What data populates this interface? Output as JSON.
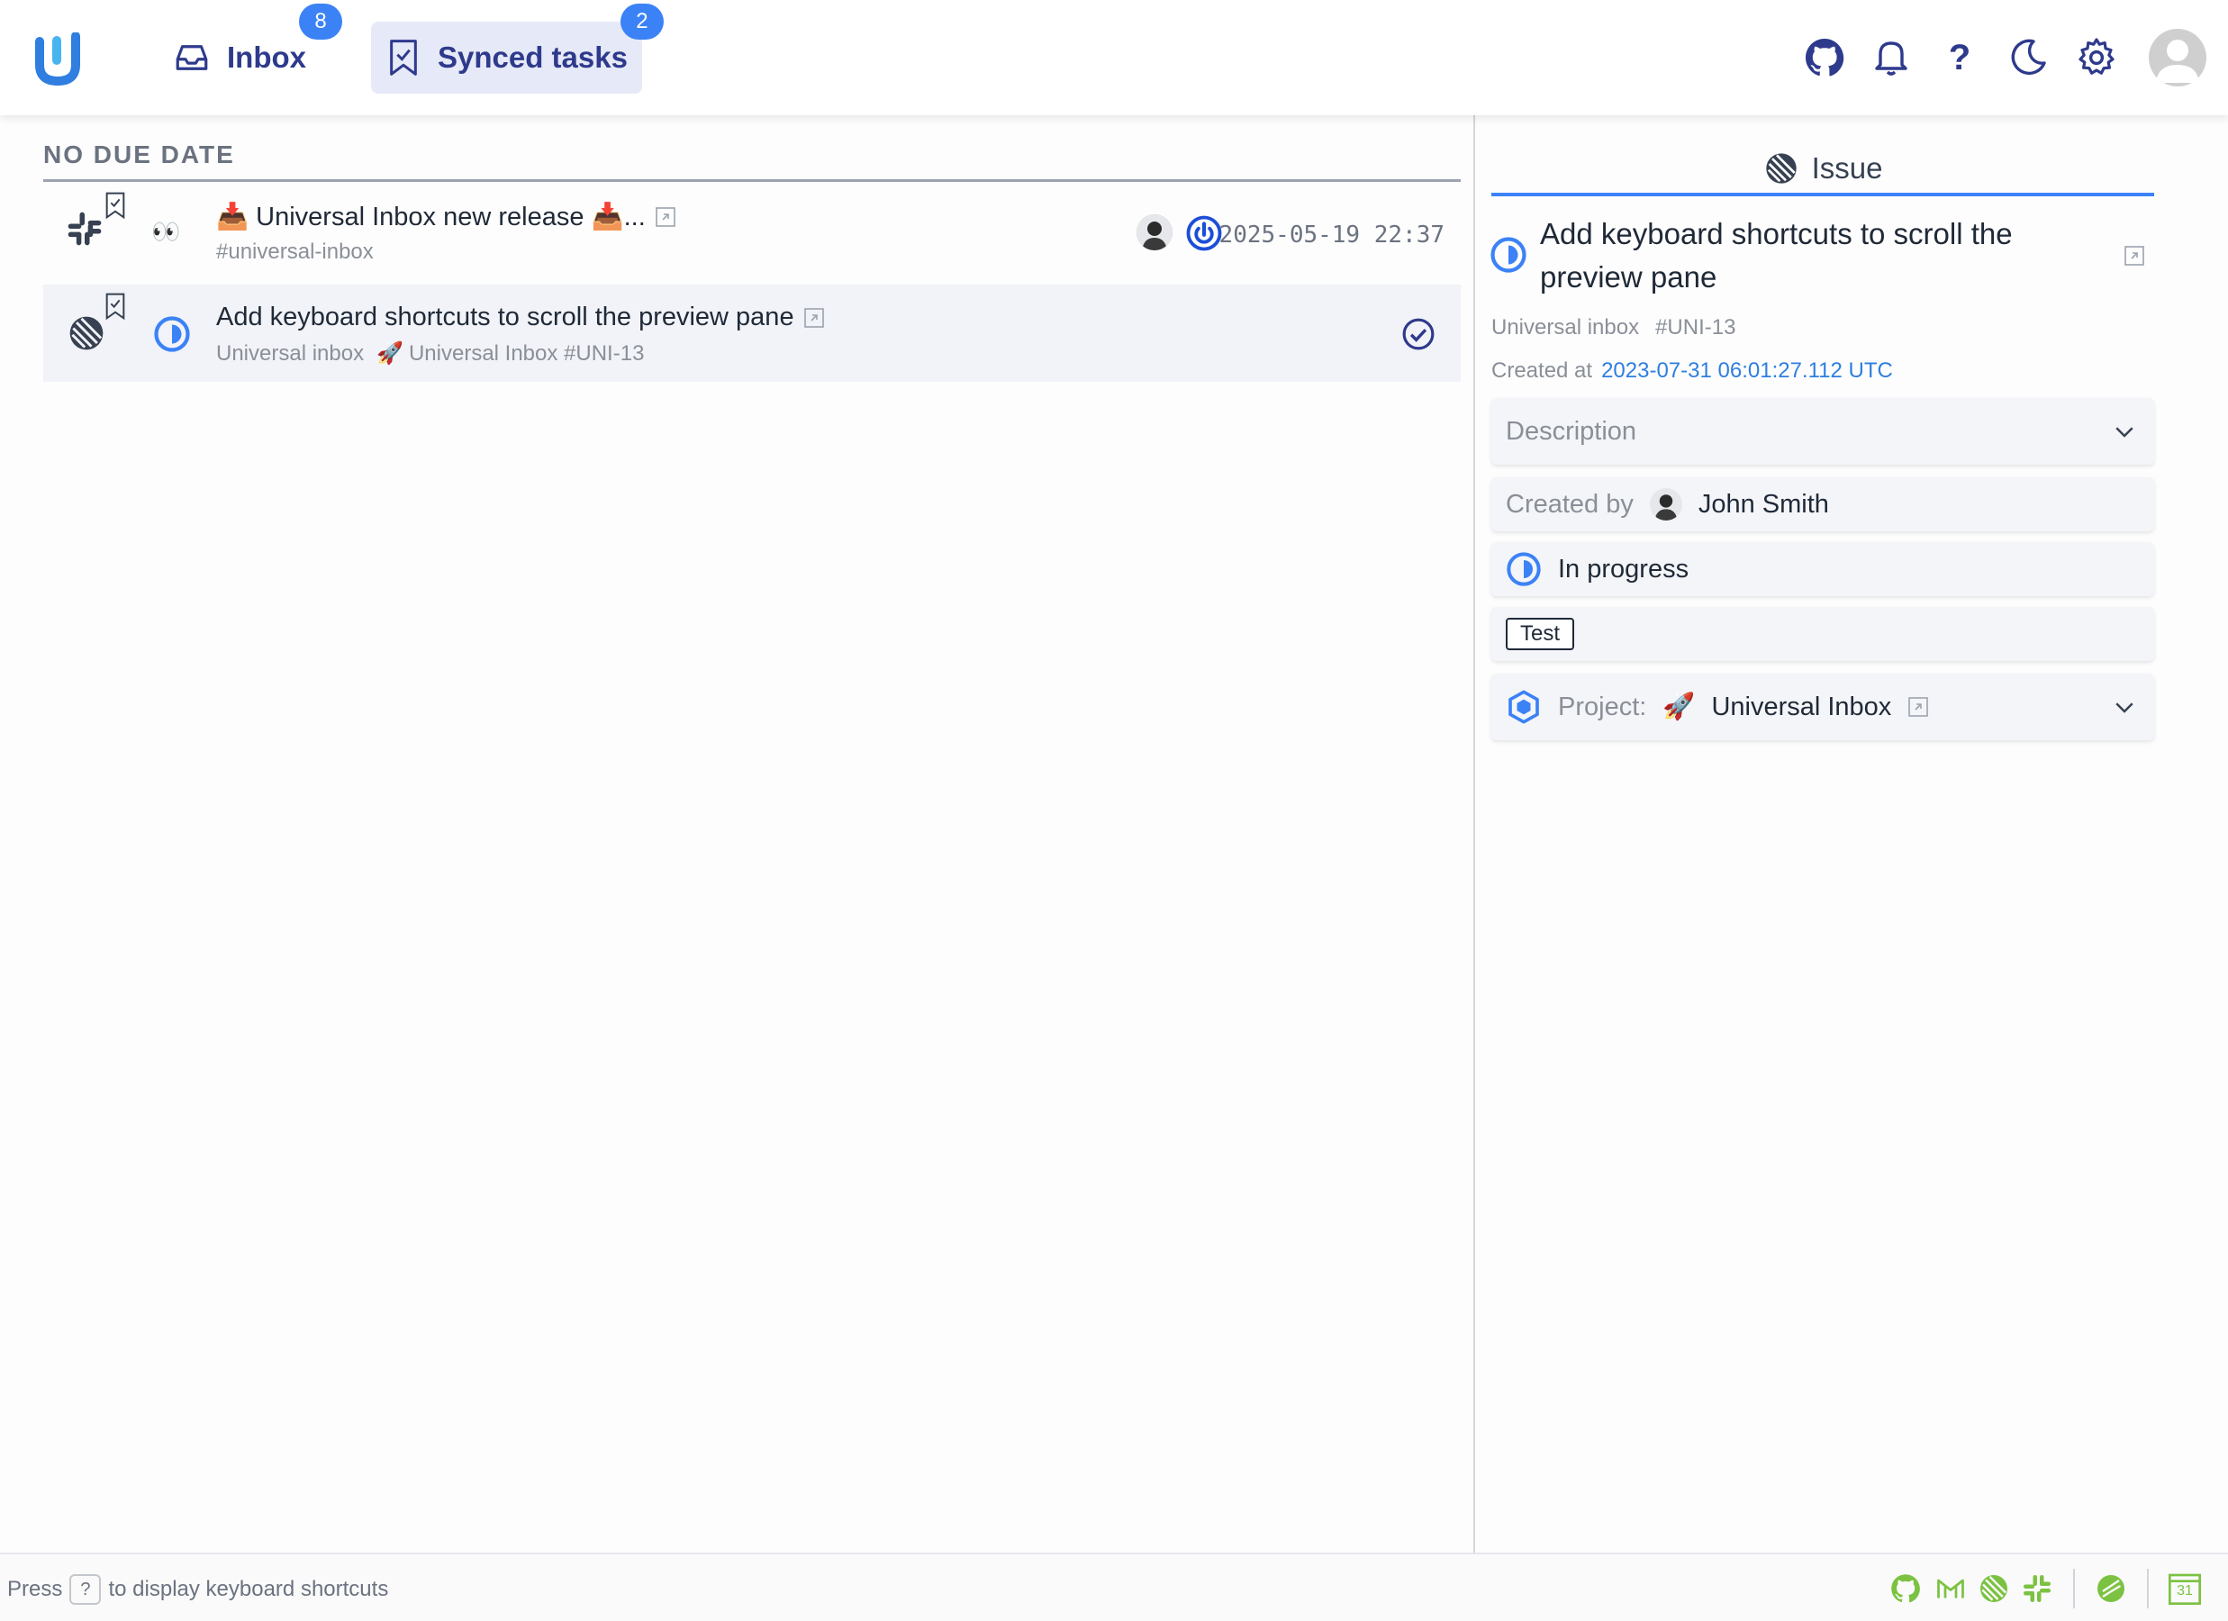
{
  "header": {
    "tabs": [
      {
        "label": "Inbox",
        "badge": "8",
        "icon": "inbox-tray-icon"
      },
      {
        "label": "Synced tasks",
        "badge": "2",
        "icon": "bookmark-check-icon"
      }
    ],
    "icons": [
      "github-icon",
      "bell-icon",
      "help-icon",
      "moon-icon",
      "gear-icon",
      "avatar"
    ],
    "question_mark": "?"
  },
  "list": {
    "section_title": "NO DUE DATE",
    "rows": [
      {
        "source_icon": "slack-icon",
        "title": "📥 Universal Inbox new release 📥...",
        "subtitle": "#universal-inbox",
        "emoji": "👀",
        "date": "2025-05-19 22:37"
      },
      {
        "source_icon": "linear-icon",
        "title": "Add keyboard shortcuts to scroll the preview pane",
        "subtitle_project": "Universal inbox",
        "subtitle_rocket": "🚀",
        "subtitle_ref": "Universal Inbox #UNI-13"
      }
    ]
  },
  "preview": {
    "header_label": "Issue",
    "title": "Add keyboard shortcuts to scroll the preview pane",
    "project": "Universal inbox",
    "ref": "#UNI-13",
    "created_label": "Created at",
    "created_value": "2023-07-31 06:01:27.112 UTC",
    "description_label": "Description",
    "created_by_label": "Created by",
    "created_by_value": "John Smith",
    "status": "In progress",
    "tag": "Test",
    "project_label": "Project:",
    "project_emoji": "🚀",
    "project_value": "Universal Inbox"
  },
  "footer": {
    "press": "Press",
    "key": "?",
    "suffix": "to display keyboard shortcuts",
    "calendar_day": "31"
  },
  "colors": {
    "accent": "#3b82f6",
    "nav_text": "#2e3a8c",
    "integration_green": "#7cc242"
  }
}
